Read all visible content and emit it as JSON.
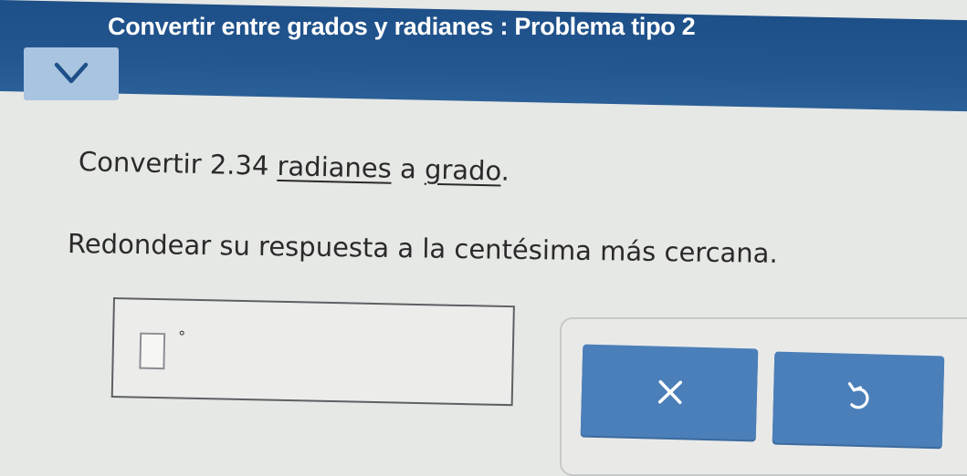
{
  "header": {
    "title": "Convertir entre grados y radianes : Problema tipo 2",
    "collapse_icon": "chevron-down-icon"
  },
  "question": {
    "prefix": "Convertir 2.34 ",
    "term1": "radianes",
    "middle": " a ",
    "term2": "grado",
    "suffix": ".",
    "instruction": "Redondear su respuesta a la centésima más cercana."
  },
  "answer": {
    "value": "",
    "unit_symbol": "°"
  },
  "keypad": {
    "clear_icon": "close-icon",
    "undo_icon": "undo-icon"
  },
  "colors": {
    "header": "#23568f",
    "accent_button": "#4b7fb9",
    "collapse_button": "#a9c4e0"
  }
}
